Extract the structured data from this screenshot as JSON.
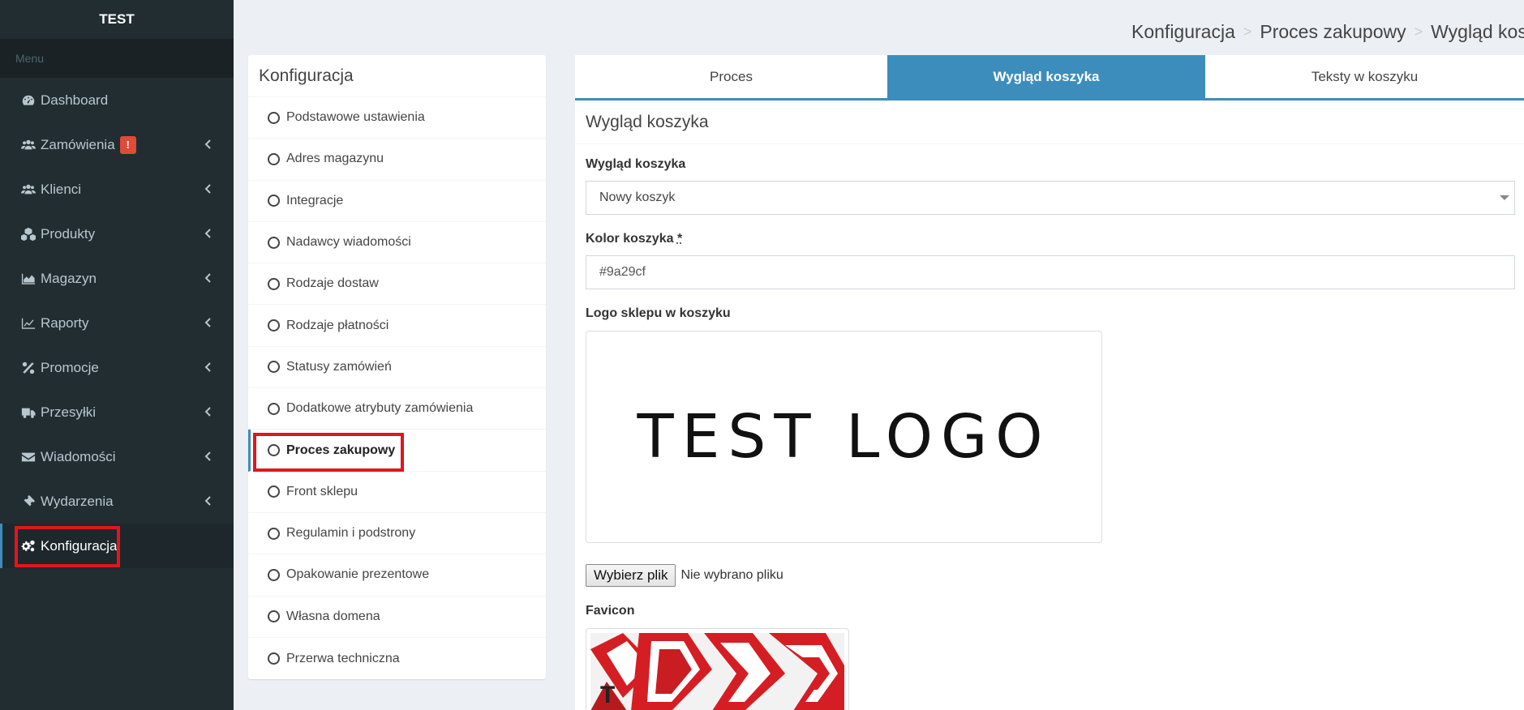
{
  "brand": "TEST",
  "menu_header": "Menu",
  "nav": [
    {
      "label": "Dashboard",
      "icon": "dashboard-icon",
      "chevron": false
    },
    {
      "label": "Zamówienia",
      "icon": "users-icon",
      "chevron": true,
      "badge": "!"
    },
    {
      "label": "Klienci",
      "icon": "users-icon",
      "chevron": true
    },
    {
      "label": "Produkty",
      "icon": "cubes-icon",
      "chevron": true
    },
    {
      "label": "Magazyn",
      "icon": "area-chart-icon",
      "chevron": true
    },
    {
      "label": "Raporty",
      "icon": "line-chart-icon",
      "chevron": true
    },
    {
      "label": "Promocje",
      "icon": "percent-icon",
      "chevron": true
    },
    {
      "label": "Przesyłki",
      "icon": "truck-icon",
      "chevron": true
    },
    {
      "label": "Wiadomości",
      "icon": "envelope-icon",
      "chevron": true
    },
    {
      "label": "Wydarzenia",
      "icon": "ticket-icon",
      "chevron": true
    },
    {
      "label": "Konfiguracja",
      "icon": "cogs-icon",
      "chevron": false,
      "active": true
    }
  ],
  "breadcrumb": [
    "Konfiguracja",
    "Proces zakupowy",
    "Wygląd koszyka"
  ],
  "config_panel": {
    "title": "Konfiguracja",
    "items": [
      "Podstawowe ustawienia",
      "Adres magazynu",
      "Integracje",
      "Nadawcy wiadomości",
      "Rodzaje dostaw",
      "Rodzaje płatności",
      "Statusy zamówień",
      "Dodatkowe atrybuty zamówienia",
      "Proces zakupowy",
      "Front sklepu",
      "Regulamin i podstrony",
      "Opakowanie prezentowe",
      "Własna domena",
      "Przerwa techniczna"
    ],
    "active_index": 8
  },
  "tabs": [
    "Proces",
    "Wygląd koszyka",
    "Teksty w koszyku"
  ],
  "active_tab": 1,
  "form": {
    "title": "Wygląd koszyka",
    "appearance_label": "Wygląd koszyka",
    "appearance_value": "Nowy koszyk",
    "color_label": "Kolor koszyka",
    "required_mark": "*",
    "color_value": "#9a29cf",
    "logo_label": "Logo sklepu w koszyku",
    "logo_text": "TEST LOGO",
    "file_button": "Wybierz plik",
    "file_status": "Nie wybrano pliku",
    "favicon_label": "Favicon"
  },
  "colors": {
    "sidebar_bg": "#222d32",
    "accent": "#3c8dbc",
    "highlight": "#e0161e",
    "badge": "#dd4b39"
  }
}
